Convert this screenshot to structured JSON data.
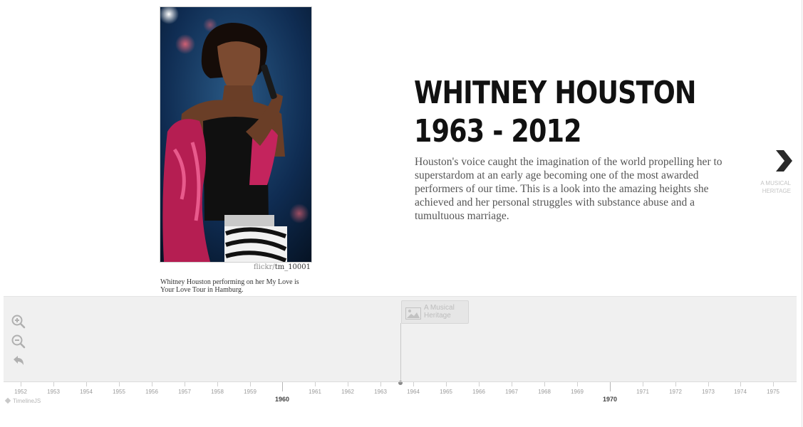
{
  "slide": {
    "headline_line1": "WHITNEY HOUSTON",
    "headline_line2": "1963 - 2012",
    "text": "Houston's voice caught the imagination of the world propelling her to superstardom at an early age becoming one of the most awarded performers of our time. This is a look into the amazing heights she achieved and her personal struggles with substance abuse and a tumultuous marriage.",
    "media": {
      "credit_source": "flickr/",
      "credit_user": "tm_10001",
      "caption": "Whitney Houston performing on her My Love is Your Love Tour in Hamburg."
    }
  },
  "nav": {
    "next_label": "A MUSICAL HERITAGE",
    "next_icon": "chevron-right-icon"
  },
  "timenav": {
    "tools": [
      {
        "name": "zoom-in-icon"
      },
      {
        "name": "zoom-out-icon"
      },
      {
        "name": "back-to-start-icon"
      }
    ],
    "marker": {
      "title": "A Musical Heritage",
      "icon": "image-icon"
    },
    "minor_years": [
      "1952",
      "1953",
      "1954",
      "1955",
      "1956",
      "1957",
      "1958",
      "1959",
      "1961",
      "1962",
      "1963",
      "1964",
      "1965",
      "1966",
      "1967",
      "1968",
      "1969",
      "1971",
      "1972",
      "1973",
      "1974",
      "1975"
    ],
    "major_years": [
      "1960",
      "1970"
    ]
  },
  "attribution": "TimelineJS",
  "colors": {
    "accent": "#111111",
    "timenav_bg": "#f0f0f0",
    "muted_text": "#9a9a9a"
  }
}
